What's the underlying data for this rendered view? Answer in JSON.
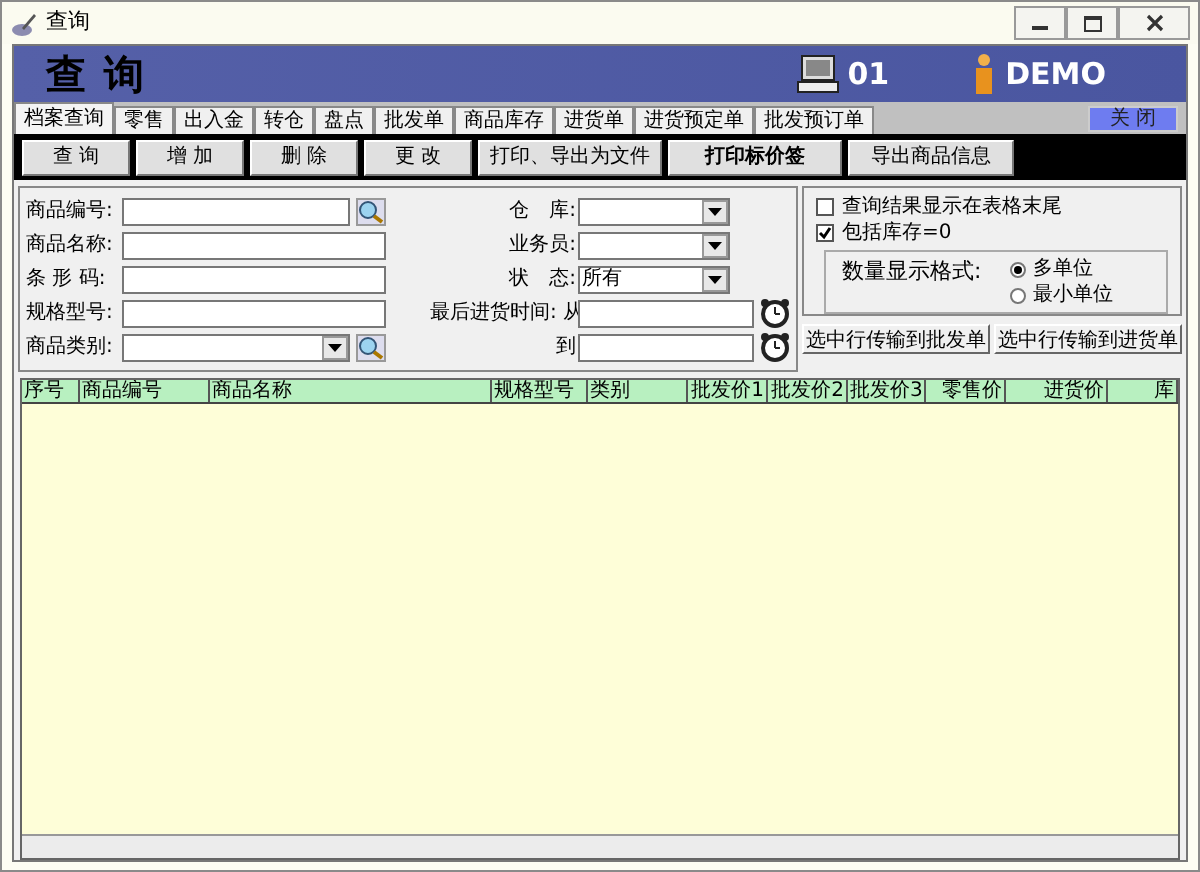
{
  "window": {
    "title": "查询"
  },
  "header": {
    "title": "查 询",
    "terminal": "01",
    "user": "DEMO"
  },
  "tabs": [
    {
      "label": "档案查询",
      "selected": true
    },
    {
      "label": "零售",
      "selected": false
    },
    {
      "label": "出入金",
      "selected": false
    },
    {
      "label": "转仓",
      "selected": false
    },
    {
      "label": "盘点",
      "selected": false
    },
    {
      "label": "批发单",
      "selected": false
    },
    {
      "label": "商品库存",
      "selected": false
    },
    {
      "label": "进货单",
      "selected": false
    },
    {
      "label": "进货预定单",
      "selected": false
    },
    {
      "label": "批发预订单",
      "selected": false
    }
  ],
  "close_button": "关 闭",
  "toolbar": [
    {
      "label": "查 询",
      "bold": false
    },
    {
      "label": "增 加",
      "bold": false
    },
    {
      "label": "删 除",
      "bold": false
    },
    {
      "label": "更 改",
      "bold": false
    },
    {
      "label": "打印、导出为文件",
      "bold": false
    },
    {
      "label": "打印标价签",
      "bold": true
    },
    {
      "label": "导出商品信息",
      "bold": false
    }
  ],
  "left_fields": [
    {
      "label": "商品编号:",
      "kind": "lookup"
    },
    {
      "label": "商品名称:",
      "kind": "text"
    },
    {
      "label": "条 形 码:",
      "kind": "text"
    },
    {
      "label": "规格型号:",
      "kind": "text"
    },
    {
      "label": "商品类别:",
      "kind": "combo-lookup"
    }
  ],
  "mid_fields": [
    {
      "label": "仓　库:",
      "kind": "combo"
    },
    {
      "label": "业务员:",
      "kind": "combo"
    },
    {
      "label": "状　态:",
      "kind": "combo",
      "value": "所有"
    },
    {
      "label": "最后进货时间: 从",
      "kind": "date"
    },
    {
      "label": "到",
      "kind": "date"
    }
  ],
  "options": [
    {
      "label": "查询结果显示在表格末尾",
      "checked": false
    },
    {
      "label": "包括库存=0",
      "checked": true
    }
  ],
  "quantity_format": {
    "label": "数量显示格式:",
    "choices": [
      {
        "label": "多单位",
        "selected": true
      },
      {
        "label": "最小单位",
        "selected": false
      }
    ]
  },
  "transfer_buttons": [
    "选中行传输到批发单",
    "选中行传输到进货单"
  ],
  "table": {
    "columns": [
      {
        "label": "序号",
        "kind": "text"
      },
      {
        "label": "商品编号",
        "kind": "text"
      },
      {
        "label": "商品名称",
        "kind": "text"
      },
      {
        "label": "规格型号",
        "kind": "text"
      },
      {
        "label": "类别",
        "kind": "text"
      },
      {
        "label": "批发价1",
        "kind": "number"
      },
      {
        "label": "批发价2",
        "kind": "number"
      },
      {
        "label": "批发价3",
        "kind": "number"
      },
      {
        "label": "零售价",
        "kind": "number"
      },
      {
        "label": "进货价",
        "kind": "number"
      },
      {
        "label": "库",
        "kind": "number"
      }
    ]
  }
}
